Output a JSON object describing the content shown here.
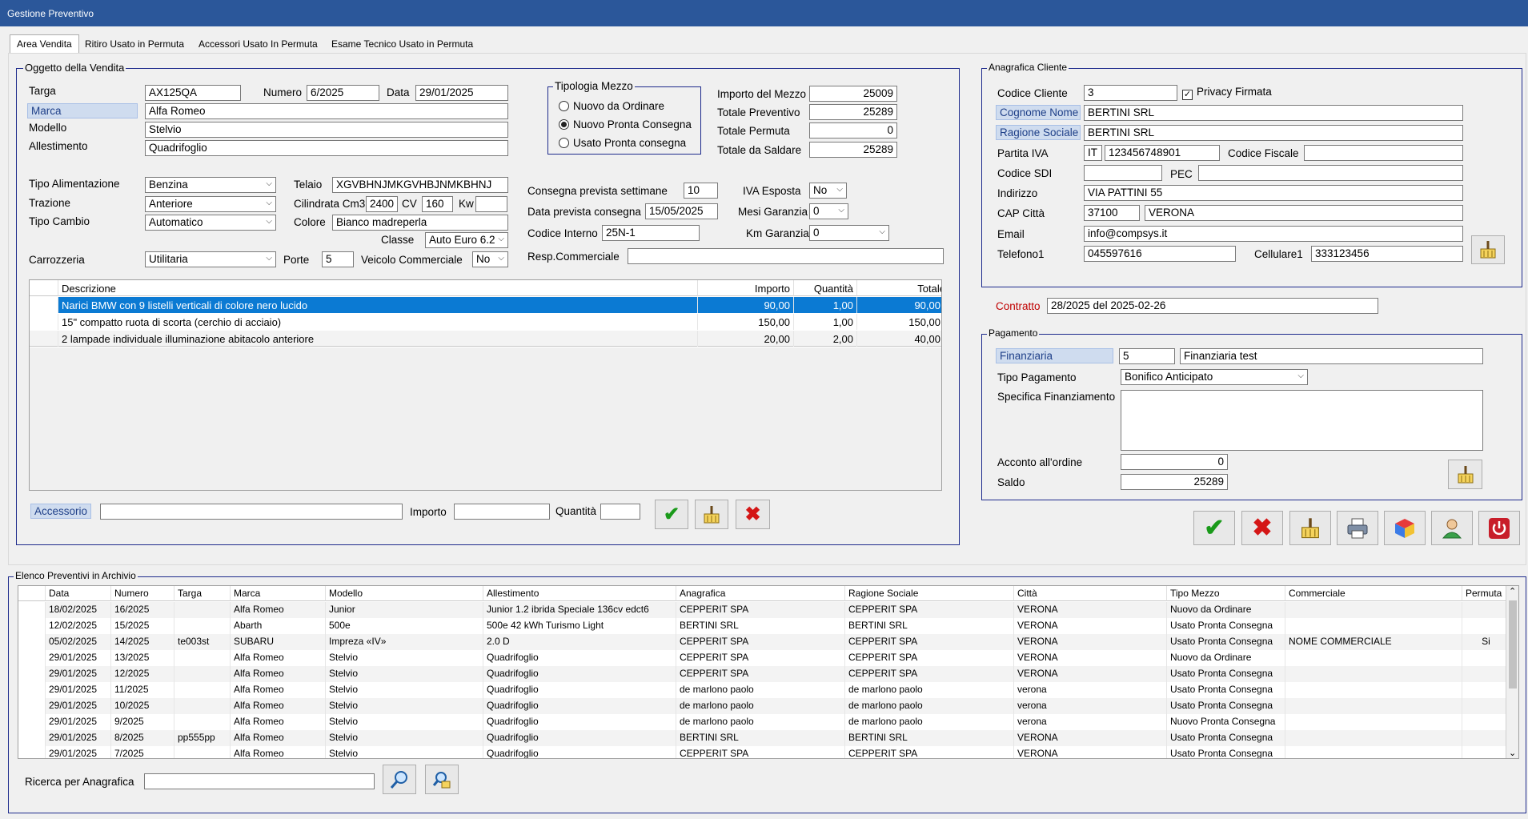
{
  "window": {
    "title": "Gestione Preventivo"
  },
  "tabs": [
    "Area Vendita",
    "Ritiro Usato in Permuta",
    "Accessori Usato In  Permuta",
    "Esame Tecnico Usato in Permuta"
  ],
  "vendita": {
    "group_title": "Oggetto della Vendita",
    "targa_label": "Targa",
    "targa": "AX125QA",
    "numero_label": "Numero",
    "numero": "6/2025",
    "data_label": "Data",
    "data": "29/01/2025",
    "marca_label": "Marca",
    "marca": "Alfa Romeo",
    "modello_label": "Modello",
    "modello": "Stelvio",
    "allestimento_label": "Allestimento",
    "allestimento": "Quadrifoglio",
    "tipo_alim_label": "Tipo Alimentazione",
    "tipo_alim": "Benzina",
    "telaio_label": "Telaio",
    "telaio": "XGVBHNJMKGVHBJNMKBHNJ",
    "trazione_label": "Trazione",
    "trazione": "Anteriore",
    "cilindrata_label": "Cilindrata Cm3",
    "cilindrata": "2400",
    "cv_label": "CV",
    "cv": "160",
    "kw_label": "Kw",
    "kw": "",
    "cambio_label": "Tipo Cambio",
    "cambio": "Automatico",
    "colore_label": "Colore",
    "colore": "Bianco madreperla",
    "classe_label": "Classe",
    "classe": "Auto Euro 6.2",
    "carrozzeria_label": "Carrozzeria",
    "carrozzeria": "Utilitaria",
    "porte_label": "Porte",
    "porte": "5",
    "commerciale_label": "Veicolo Commerciale",
    "commerciale": "No"
  },
  "tipologia": {
    "title": "Tipologia Mezzo",
    "options": [
      "Nuovo da Ordinare",
      "Nuovo Pronta Consegna",
      "Usato Pronta consegna"
    ],
    "selected": 1
  },
  "importi": {
    "mezzo_label": "Importo del Mezzo",
    "mezzo": "25009",
    "preventivo_label": "Totale Preventivo",
    "preventivo": "25289",
    "permuta_label": "Totale Permuta",
    "permuta": "0",
    "saldare_label": "Totale da Saldare",
    "saldare": "25289"
  },
  "consegna": {
    "settimane_label": "Consegna prevista settimane",
    "settimane": "10",
    "iva_label": "IVA Esposta",
    "iva": "No",
    "data_label": "Data prevista consegna",
    "data": "15/05/2025",
    "mesi_label": "Mesi Garanzia",
    "mesi": "0",
    "codice_label": "Codice Interno",
    "codice": "25N-1",
    "km_label": "Km Garanzia",
    "km": "0",
    "resp_label": "Resp.Commerciale",
    "resp": ""
  },
  "accessori": {
    "headers": [
      "Descrizione",
      "Importo",
      "Quantità",
      "Totale"
    ],
    "rows": [
      [
        "Narici BMW con 9 listelli verticali di colore nero lucido",
        "90,00",
        "1,00",
        "90,00"
      ],
      [
        "15\" compatto ruota di scorta (cerchio di acciaio)",
        "150,00",
        "1,00",
        "150,00"
      ],
      [
        "2 lampade individuale illuminazione abitacolo anteriore",
        "20,00",
        "2,00",
        "40,00"
      ]
    ],
    "accessorio_label": "Accessorio",
    "importo_label": "Importo",
    "quantita_label": "Quantità"
  },
  "cliente": {
    "title": "Anagrafica Cliente",
    "codice_label": "Codice Cliente",
    "codice": "3",
    "privacy_label": "Privacy Firmata",
    "cognome_label": "Cognome Nome",
    "cognome": "BERTINI SRL",
    "ragione_label": "Ragione Sociale",
    "ragione": "BERTINI SRL",
    "piva_label": "Partita IVA",
    "piva_prefix": "IT",
    "piva": "123456748901",
    "cf_label": "Codice Fiscale",
    "cf": "",
    "sdi_label": "Codice SDI",
    "sdi": "",
    "pec_label": "PEC",
    "pec": "",
    "indirizzo_label": "Indirizzo",
    "indirizzo": "VIA PATTINI 55",
    "cap_label": "CAP Città",
    "cap": "37100",
    "citta": "VERONA",
    "email_label": "Email",
    "email": "info@compsys.it",
    "tel_label": "Telefono1",
    "tel": "045597616",
    "cell_label": "Cellulare1",
    "cell": "333123456"
  },
  "contratto": {
    "label": "Contratto",
    "value": "28/2025 del 2025-02-26"
  },
  "pagamento": {
    "title": "Pagamento",
    "fin_label": "Finanziaria",
    "fin_code": "5",
    "fin_name": "Finanziaria test",
    "tipo_label": "Tipo Pagamento",
    "tipo": "Bonifico Anticipato",
    "spec_label": "Specifica Finanziamento",
    "spec": "",
    "acconto_label": "Acconto all'ordine",
    "acconto": "0",
    "saldo_label": "Saldo",
    "saldo": "25289"
  },
  "archivio": {
    "title": "Elenco Preventivi in Archivio",
    "headers": [
      "Data",
      "Numero",
      "Targa",
      "Marca",
      "Modello",
      "Allestimento",
      "Anagrafica",
      "Ragione Sociale",
      "Città",
      "Tipo Mezzo",
      "Commerciale",
      "Permuta"
    ],
    "rows": [
      [
        "18/02/2025",
        "16/2025",
        "",
        "Alfa Romeo",
        "Junior",
        "Junior 1.2 ibrida Speciale 136cv edct6",
        "CEPPERIT SPA",
        "CEPPERIT SPA",
        "VERONA",
        "Nuovo da Ordinare",
        "",
        ""
      ],
      [
        "12/02/2025",
        "15/2025",
        "",
        "Abarth",
        "500e",
        "500e 42 kWh Turismo Light",
        "BERTINI SRL",
        "BERTINI SRL",
        "VERONA",
        "Usato Pronta Consegna",
        "",
        ""
      ],
      [
        "05/02/2025",
        "14/2025",
        "te003st",
        "SUBARU",
        "Impreza «IV»",
        "2.0 D",
        "CEPPERIT SPA",
        "CEPPERIT SPA",
        "VERONA",
        "Usato Pronta Consegna",
        "NOME COMMERCIALE",
        "Si"
      ],
      [
        "29/01/2025",
        "13/2025",
        "",
        "Alfa Romeo",
        "Stelvio",
        "Quadrifoglio",
        "CEPPERIT SPA",
        "CEPPERIT SPA",
        "VERONA",
        "Nuovo da Ordinare",
        "",
        ""
      ],
      [
        "29/01/2025",
        "12/2025",
        "",
        "Alfa Romeo",
        "Stelvio",
        "Quadrifoglio",
        "CEPPERIT SPA",
        "CEPPERIT SPA",
        "VERONA",
        "Usato Pronta Consegna",
        "",
        ""
      ],
      [
        "29/01/2025",
        "11/2025",
        "",
        "Alfa Romeo",
        "Stelvio",
        "Quadrifoglio",
        "de marlono paolo",
        "de marlono paolo",
        "verona",
        "Usato Pronta Consegna",
        "",
        ""
      ],
      [
        "29/01/2025",
        "10/2025",
        "",
        "Alfa Romeo",
        "Stelvio",
        "Quadrifoglio",
        "de marlono paolo",
        "de marlono paolo",
        "verona",
        "Usato Pronta Consegna",
        "",
        ""
      ],
      [
        "29/01/2025",
        "9/2025",
        "",
        "Alfa Romeo",
        "Stelvio",
        "Quadrifoglio",
        "de marlono paolo",
        "de marlono paolo",
        "verona",
        "Nuovo Pronta Consegna",
        "",
        ""
      ],
      [
        "29/01/2025",
        "8/2025",
        "pp555pp",
        "Alfa Romeo",
        "Stelvio",
        "Quadrifoglio",
        "BERTINI SRL",
        "BERTINI SRL",
        "VERONA",
        "Usato Pronta Consegna",
        "",
        ""
      ],
      [
        "29/01/2025",
        "7/2025",
        "",
        "Alfa Romeo",
        "Stelvio",
        "Quadrifoglio",
        "CEPPERIT SPA",
        "CEPPERIT SPA",
        "VERONA",
        "Usato Pronta Consegna",
        "",
        ""
      ]
    ],
    "ricerca_label": "Ricerca per Anagrafica",
    "ricerca": ""
  }
}
